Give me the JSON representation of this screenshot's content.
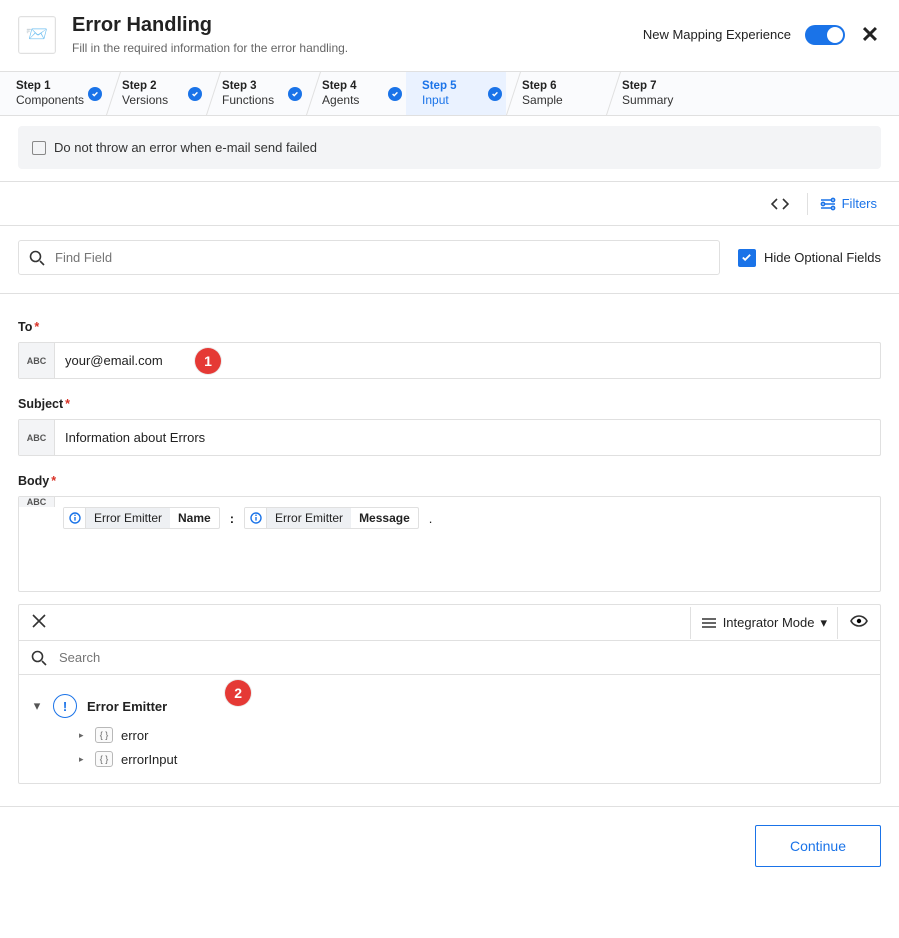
{
  "header": {
    "title": "Error Handling",
    "subtitle": "Fill in the required information for the error handling.",
    "nme_label": "New Mapping Experience",
    "nme_on": true
  },
  "stepper": {
    "steps": [
      {
        "top": "Step 1",
        "bot": "Components",
        "done": true
      },
      {
        "top": "Step 2",
        "bot": "Versions",
        "done": true
      },
      {
        "top": "Step 3",
        "bot": "Functions",
        "done": true
      },
      {
        "top": "Step 4",
        "bot": "Agents",
        "done": true
      },
      {
        "top": "Step 5",
        "bot": "Input",
        "done": true,
        "active": true
      },
      {
        "top": "Step 6",
        "bot": "Sample",
        "done": false
      },
      {
        "top": "Step 7",
        "bot": "Summary",
        "done": false
      }
    ]
  },
  "banner": {
    "chk": false,
    "text": "Do not throw an error when e-mail send failed"
  },
  "toolbar": {
    "filters_label": "Filters"
  },
  "search": {
    "placeholder": "Find Field",
    "hide_label": "Hide Optional Fields",
    "hide_on": true
  },
  "fields": {
    "abc": "ABC",
    "to": {
      "label": "To",
      "value": "your@email.com"
    },
    "subject": {
      "label": "Subject",
      "value": "Information about Errors"
    },
    "body": {
      "label": "Body",
      "chips": [
        {
          "src": "Error Emitter",
          "key": "Name"
        },
        {
          "src": "Error Emitter",
          "key": "Message"
        }
      ],
      "colon": ":",
      "dot": "."
    }
  },
  "mapper": {
    "mode_label": "Integrator Mode",
    "search_placeholder": "Search",
    "tree": {
      "root": "Error Emitter",
      "children": [
        {
          "name": "error"
        },
        {
          "name": "errorInput"
        }
      ]
    }
  },
  "callouts": {
    "one": "1",
    "two": "2"
  },
  "footer": {
    "continue": "Continue"
  }
}
